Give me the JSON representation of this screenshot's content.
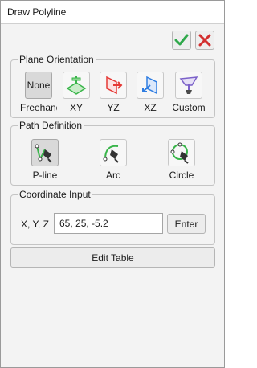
{
  "title": "Draw Polyline",
  "actions": {
    "accept_icon": "checkmark-icon",
    "cancel_icon": "close-icon"
  },
  "plane": {
    "legend": "Plane Orientation",
    "items": [
      {
        "label": "Freehand",
        "box_text": "None",
        "icon": "none",
        "selected": true
      },
      {
        "label": "XY",
        "icon": "xy-plane-icon"
      },
      {
        "label": "YZ",
        "icon": "yz-plane-icon"
      },
      {
        "label": "XZ",
        "icon": "xz-plane-icon"
      },
      {
        "label": "Custom",
        "icon": "custom-plane-icon"
      }
    ]
  },
  "path": {
    "legend": "Path Definition",
    "items": [
      {
        "label": "P-line",
        "icon": "polyline-pen-icon",
        "selected": true
      },
      {
        "label": "Arc",
        "icon": "arc-pen-icon"
      },
      {
        "label": "Circle",
        "icon": "circle-pen-icon"
      }
    ]
  },
  "coord": {
    "legend": "Coordinate Input",
    "label": "X, Y, Z",
    "value": "65, 25, -5.2",
    "enter": "Enter"
  },
  "edit_table": "Edit Table",
  "colors": {
    "accept": "#2ea84a",
    "cancel": "#d32f2f",
    "green": "#39b54a",
    "red": "#e53935",
    "blue": "#2f7de1",
    "purple": "#7b61c9"
  }
}
